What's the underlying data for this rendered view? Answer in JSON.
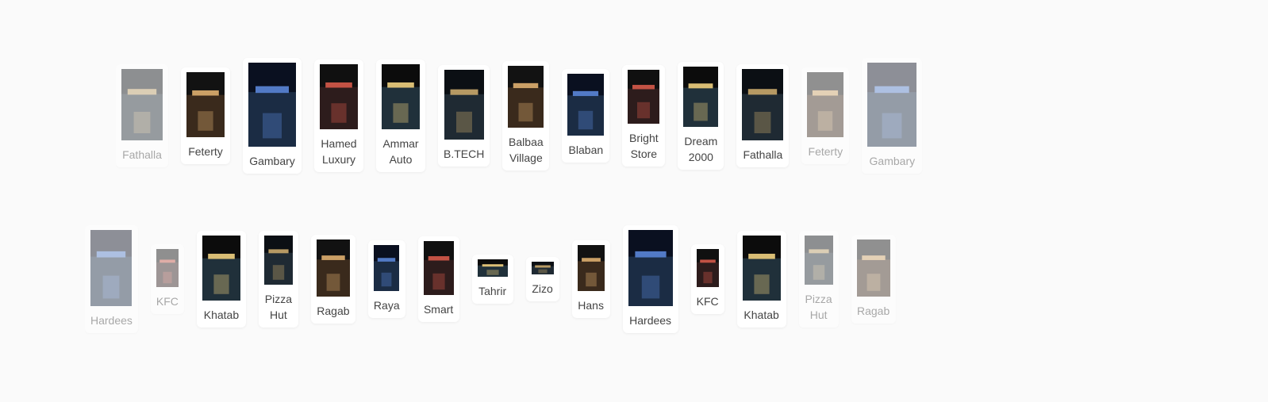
{
  "section": {
    "title": "",
    "background": "#fafafa"
  },
  "row1": [
    {
      "label": "Fathalla",
      "photo": "fathalla-storefront-photo",
      "faded": true
    },
    {
      "label": "Feterty",
      "photo": "feterty-storefront-photo",
      "faded": false
    },
    {
      "label": "Gambary",
      "photo": "gambary-storefront-photo",
      "faded": false
    },
    {
      "label": "Hamed\nLuxury",
      "photo": "hamed-luxury-storefront-photo",
      "faded": false
    },
    {
      "label": "Ammar\nAuto",
      "photo": "ammar-auto-storefront-photo",
      "faded": false
    },
    {
      "label": "B.TECH",
      "photo": "btech-storefront-photo",
      "faded": false
    },
    {
      "label": "Balbaa\nVillage",
      "photo": "balbaa-village-storefront-photo",
      "faded": false
    },
    {
      "label": "Blaban",
      "photo": "blaban-storefront-photo",
      "faded": false
    },
    {
      "label": "Bright\nStore",
      "photo": "bright-store-storefront-photo",
      "faded": false
    },
    {
      "label": "Dream\n2000",
      "photo": "dream-2000-storefront-photo",
      "faded": false
    },
    {
      "label": "Fathalla",
      "photo": "fathalla-storefront-photo",
      "faded": false
    },
    {
      "label": "Feterty",
      "photo": "feterty-storefront-photo",
      "faded": true
    },
    {
      "label": "Gambary",
      "photo": "gambary-storefront-photo",
      "faded": true
    }
  ],
  "row2": [
    {
      "label": "Hardees",
      "photo": "hardees-storefront-photo",
      "faded": true
    },
    {
      "label": "KFC",
      "photo": "kfc-storefront-photo",
      "faded": true
    },
    {
      "label": "Khatab",
      "photo": "khatab-storefront-photo",
      "faded": false
    },
    {
      "label": "Pizza\nHut",
      "photo": "pizza-hut-storefront-photo",
      "faded": false
    },
    {
      "label": "Ragab",
      "photo": "ragab-storefront-photo",
      "faded": false
    },
    {
      "label": "Raya",
      "photo": "raya-storefront-photo",
      "faded": false
    },
    {
      "label": "Smart",
      "photo": "smart-storefront-photo",
      "faded": false
    },
    {
      "label": "Tahrir",
      "photo": "tahrir-storefront-photo",
      "faded": false
    },
    {
      "label": "Zizo",
      "photo": "zizo-storefront-photo",
      "faded": false
    },
    {
      "label": "Hans",
      "photo": "hans-storefront-photo",
      "faded": false
    },
    {
      "label": "Hardees",
      "photo": "hardees-storefront-photo",
      "faded": false
    },
    {
      "label": "KFC",
      "photo": "kfc-storefront-photo",
      "faded": false
    },
    {
      "label": "Khatab",
      "photo": "khatab-storefront-photo",
      "faded": false
    },
    {
      "label": "Pizza\nHut",
      "photo": "pizza-hut-storefront-photo",
      "faded": true
    },
    {
      "label": "Ragab",
      "photo": "ragab-storefront-photo",
      "faded": true
    }
  ]
}
